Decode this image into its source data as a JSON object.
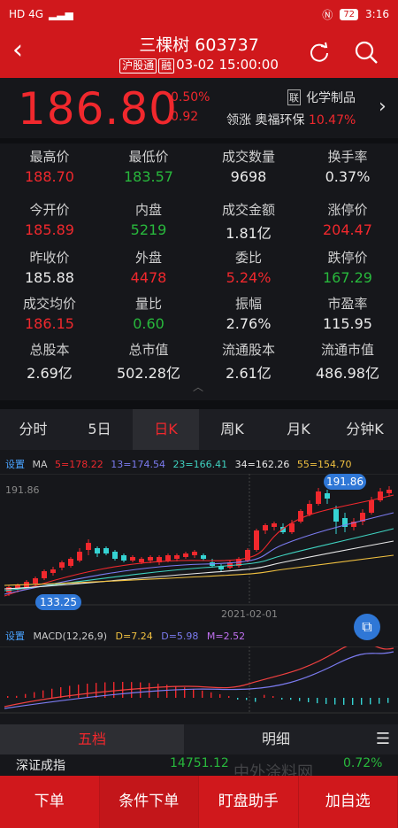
{
  "status_bar": {
    "left": "HD 4G",
    "battery": "72",
    "time": "3:16"
  },
  "header": {
    "name": "三棵树",
    "code": "603737",
    "tag1": "沪股通",
    "tag2": "融",
    "datetime": "03-02 15:00:00"
  },
  "quote": {
    "price": "186.80",
    "change_pct": "0.50%",
    "change": "0.92",
    "sector_tag": "联",
    "sector": "化学制品",
    "leader_label": "领涨",
    "leader_name": "奥福环保",
    "leader_pct": "10.47%"
  },
  "stats": [
    {
      "label": "最高价",
      "value": "188.70",
      "color": "red"
    },
    {
      "label": "最低价",
      "value": "183.57",
      "color": "green"
    },
    {
      "label": "成交数量",
      "value": "9698",
      "color": "white"
    },
    {
      "label": "换手率",
      "value": "0.37%",
      "color": "white"
    },
    {
      "label": "今开价",
      "value": "185.89",
      "color": "red"
    },
    {
      "label": "内盘",
      "value": "5219",
      "color": "green"
    },
    {
      "label": "成交金额",
      "value": "1.81亿",
      "color": "white"
    },
    {
      "label": "涨停价",
      "value": "204.47",
      "color": "red"
    },
    {
      "label": "昨收价",
      "value": "185.88",
      "color": "white"
    },
    {
      "label": "外盘",
      "value": "4478",
      "color": "red"
    },
    {
      "label": "委比",
      "value": "5.24%",
      "color": "red"
    },
    {
      "label": "跌停价",
      "value": "167.29",
      "color": "green"
    },
    {
      "label": "成交均价",
      "value": "186.15",
      "color": "red"
    },
    {
      "label": "量比",
      "value": "0.60",
      "color": "green"
    },
    {
      "label": "振幅",
      "value": "2.76%",
      "color": "white"
    },
    {
      "label": "市盈率",
      "value": "115.95",
      "color": "white"
    },
    {
      "label": "总股本",
      "value": "2.69亿",
      "color": "white"
    },
    {
      "label": "总市值",
      "value": "502.28亿",
      "color": "white"
    },
    {
      "label": "流通股本",
      "value": "2.61亿",
      "color": "white"
    },
    {
      "label": "流通市值",
      "value": "486.98亿",
      "color": "white"
    }
  ],
  "tabs": [
    "分时",
    "5日",
    "日K",
    "周K",
    "月K",
    "分钟K"
  ],
  "ma_legend": {
    "setting": "设置",
    "title": "MA",
    "ma5": "5=178.22",
    "ma13": "13=174.54",
    "ma23": "23=166.41",
    "ma34": "34=162.26",
    "ma55": "55=154.70"
  },
  "kline": {
    "high_label": "191.86",
    "low_label": "133.25",
    "date_label": "2021-02-01",
    "left_axis_label": "191.86"
  },
  "macd_legend": {
    "setting": "设置",
    "title": "MACD(12,26,9)",
    "d1": "D=7.24",
    "d2": "D=5.98",
    "m": "M=2.52"
  },
  "bottom_tabs": [
    "五档",
    "明细"
  ],
  "index": {
    "name": "深证成指",
    "value": "14751.12",
    "pct": "0.72%"
  },
  "watermark": "中外涂料网",
  "actions": [
    "下单",
    "条件下单",
    "盯盘助手",
    "加自选"
  ],
  "colors": {
    "up": "#f0282d",
    "down": "#28b83c",
    "header": "#d0181c",
    "ma5": "#f0282d",
    "ma13": "#7b7bf0",
    "ma23": "#3fd2c0",
    "ma34": "#e8e8e8",
    "ma55": "#f0c040"
  }
}
